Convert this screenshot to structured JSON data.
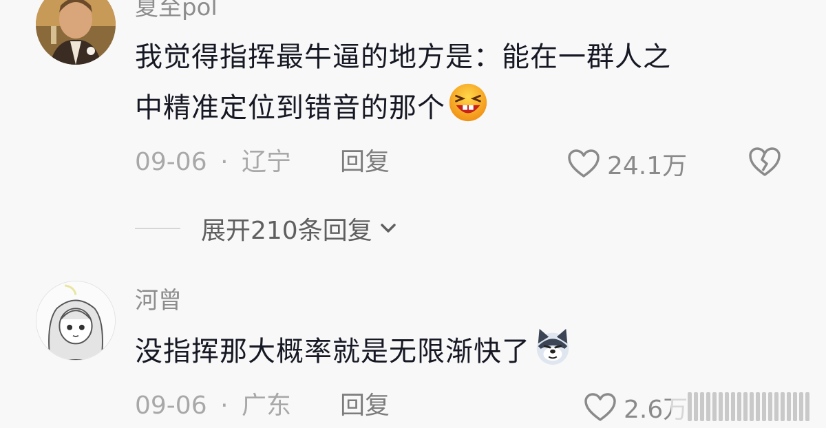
{
  "comments": [
    {
      "username": "夏至pol",
      "text_line1": "我觉得指挥最牛逼的地方是：能在一群人之",
      "text_line2": "中精准定位到错音的那个",
      "emoji": "laughing-emoji",
      "date": "09-06",
      "separator": "·",
      "location": "辽宁",
      "reply_label": "回复",
      "like_count": "24.1万",
      "expand_label": "展开210条回复"
    },
    {
      "username": "河曾",
      "text": "没指挥那大概率就是无限渐快了",
      "emoji": "husky-dog-emoji",
      "date": "09-06",
      "separator": "·",
      "location": "广东",
      "reply_label": "回复",
      "like_count": "2.6万"
    }
  ],
  "icons": {
    "like": "heart-icon",
    "dislike": "broken-heart-icon",
    "expand": "chevron-down-icon"
  },
  "colors": {
    "background": "#f8f8f8",
    "text": "#161823",
    "secondary": "#a8a8a8"
  }
}
